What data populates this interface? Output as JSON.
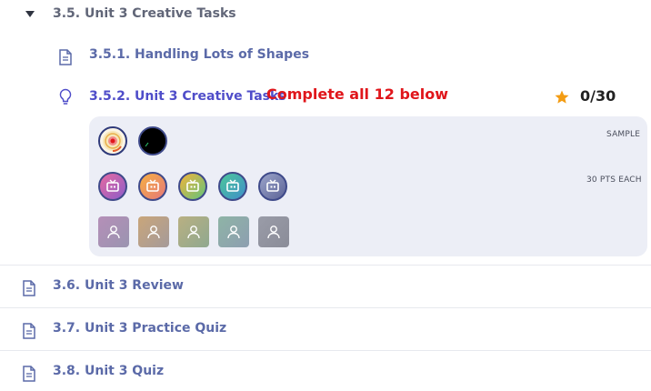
{
  "section": {
    "label": "3.5. Unit 3 Creative Tasks"
  },
  "items": {
    "shapes": {
      "label": "3.5.1. Handling Lots of Shapes"
    },
    "creative": {
      "label": "3.5.2. Unit 3 Creative Tasks",
      "note": "Complete all 12 below",
      "score": "0/30"
    }
  },
  "panel": {
    "sample_caption": "SAMPLE",
    "points_caption": "30 PTS EACH"
  },
  "lessons": [
    {
      "label": "3.6. Unit 3 Review"
    },
    {
      "label": "3.7. Unit 3 Practice Quiz"
    },
    {
      "label": "3.8. Unit 3 Quiz"
    }
  ],
  "colors": {
    "accent_red": "#e0161b",
    "star": "#f39c12",
    "link": "#5b6aa8",
    "active": "#4f4dc9",
    "panel_bg": "#eceef6"
  },
  "icons": [
    "chevron-down-icon",
    "document-icon",
    "lightbulb-icon",
    "star-icon",
    "tv-icon",
    "user-icon"
  ]
}
